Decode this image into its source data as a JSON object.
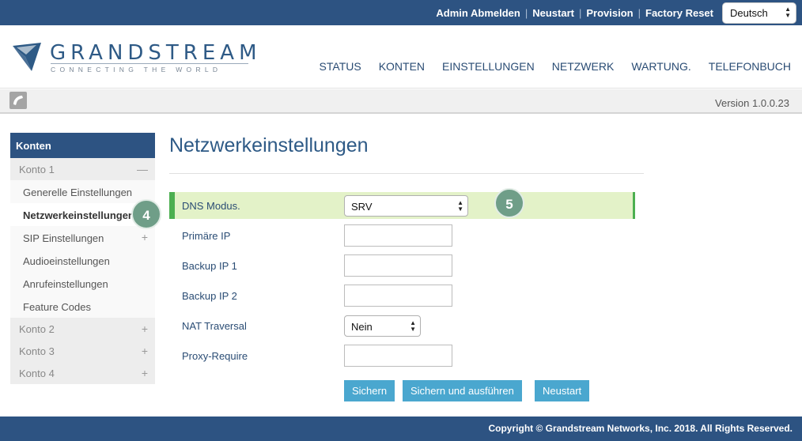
{
  "topbar": {
    "links": [
      "Admin Abmelden",
      "Neustart",
      "Provision",
      "Factory Reset"
    ],
    "language": "Deutsch"
  },
  "header": {
    "brand": "GRANDSTREAM",
    "tagline": "CONNECTING THE WORLD",
    "nav": [
      "STATUS",
      "KONTEN",
      "EINSTELLUNGEN",
      "NETZWERK",
      "WARTUNG.",
      "TELEFONBUCH"
    ]
  },
  "subbar": {
    "version": "Version 1.0.0.23"
  },
  "sidebar": {
    "title": "Konten",
    "accounts": [
      {
        "label": "Konto 1",
        "expanded": true
      },
      {
        "label": "Konto 2",
        "expanded": false
      },
      {
        "label": "Konto 3",
        "expanded": false
      },
      {
        "label": "Konto 4",
        "expanded": false
      }
    ],
    "subitems": [
      {
        "label": "Generelle Einstellungen"
      },
      {
        "label": "Netzwerkeinstellungen",
        "active": true
      },
      {
        "label": "SIP Einstellungen"
      },
      {
        "label": "Audioeinstellungen"
      },
      {
        "label": "Anrufeinstellungen"
      },
      {
        "label": "Feature Codes"
      }
    ]
  },
  "main": {
    "title": "Netzwerkeinstellungen",
    "fields": {
      "dns_mode": {
        "label": "DNS Modus.",
        "value": "SRV"
      },
      "primary_ip": {
        "label": "Primäre IP",
        "value": ""
      },
      "backup_ip1": {
        "label": "Backup IP 1",
        "value": ""
      },
      "backup_ip2": {
        "label": "Backup IP 2",
        "value": ""
      },
      "nat": {
        "label": "NAT Traversal",
        "value": "Nein"
      },
      "proxy_require": {
        "label": "Proxy-Require",
        "value": ""
      }
    },
    "buttons": {
      "save": "Sichern",
      "save_apply": "Sichern und ausführen",
      "reset": "Neustart"
    }
  },
  "badges": {
    "step4": "4",
    "step5": "5"
  },
  "footer": {
    "copyright": "Copyright © Grandstream Networks, Inc. 2018. All Rights Reserved."
  },
  "colors": {
    "primary": "#2d5382",
    "accent": "#4aa7cf",
    "highlight": "#e3f2c8",
    "highlight_border": "#4caf50",
    "badge": "#6f9e88"
  }
}
